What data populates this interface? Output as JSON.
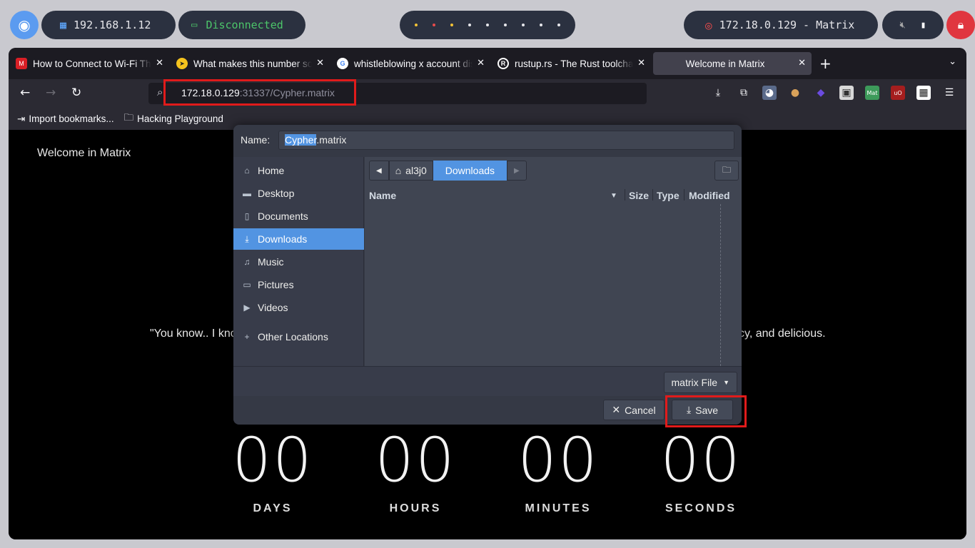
{
  "topbar": {
    "ip": "192.168.1.12",
    "vpn_status": "Disconnected",
    "target": "172.18.0.129 - Matrix"
  },
  "browser": {
    "tabs": [
      {
        "title": "How to Connect to Wi-Fi Through the Linux Terminal",
        "favicon": "muo-icon",
        "color": "#d91f26"
      },
      {
        "title": "What makes this number so special",
        "favicon": "compass-icon",
        "color": "#f4c31e"
      },
      {
        "title": "whistleblowing x account discovery",
        "favicon": "google-icon",
        "color": "#4285f4"
      },
      {
        "title": "rustup.rs - The Rust toolchain installer",
        "favicon": "rust-icon",
        "color": "#ffffff"
      },
      {
        "title": "Welcome in Matrix",
        "favicon": "",
        "color": ""
      }
    ],
    "url_host": "172.18.0.129",
    "url_rest": ":31337/Cypher.matrix",
    "bookmarks": [
      {
        "label": "Import bookmarks...",
        "icon": "import-icon"
      },
      {
        "label": "Hacking Playground",
        "icon": "folder-icon"
      }
    ]
  },
  "page": {
    "heading": "Welcome in Matrix",
    "quote_left": "\"You know.. I kno",
    "quote_right": "cy, and delicious.",
    "countdown": [
      {
        "value": "00",
        "label": "DAYS"
      },
      {
        "value": "00",
        "label": "HOURS"
      },
      {
        "value": "00",
        "label": "MINUTES"
      },
      {
        "value": "00",
        "label": "SECONDS"
      }
    ]
  },
  "dialog": {
    "name_label": "Name:",
    "name_selected": "Cypher",
    "name_rest": ".matrix",
    "places": [
      {
        "label": "Home",
        "icon": "home-icon"
      },
      {
        "label": "Desktop",
        "icon": "desktop-icon"
      },
      {
        "label": "Documents",
        "icon": "document-icon"
      },
      {
        "label": "Downloads",
        "icon": "download-icon",
        "active": true
      },
      {
        "label": "Music",
        "icon": "music-icon"
      },
      {
        "label": "Pictures",
        "icon": "picture-icon"
      },
      {
        "label": "Videos",
        "icon": "video-icon"
      },
      {
        "label": "Other Locations",
        "icon": "plus-icon"
      }
    ],
    "path": [
      "al3j0",
      "Downloads"
    ],
    "columns": [
      "Name",
      "Size",
      "Type",
      "Modified"
    ],
    "filter": "matrix File",
    "cancel_label": "Cancel",
    "save_label": "Save"
  }
}
